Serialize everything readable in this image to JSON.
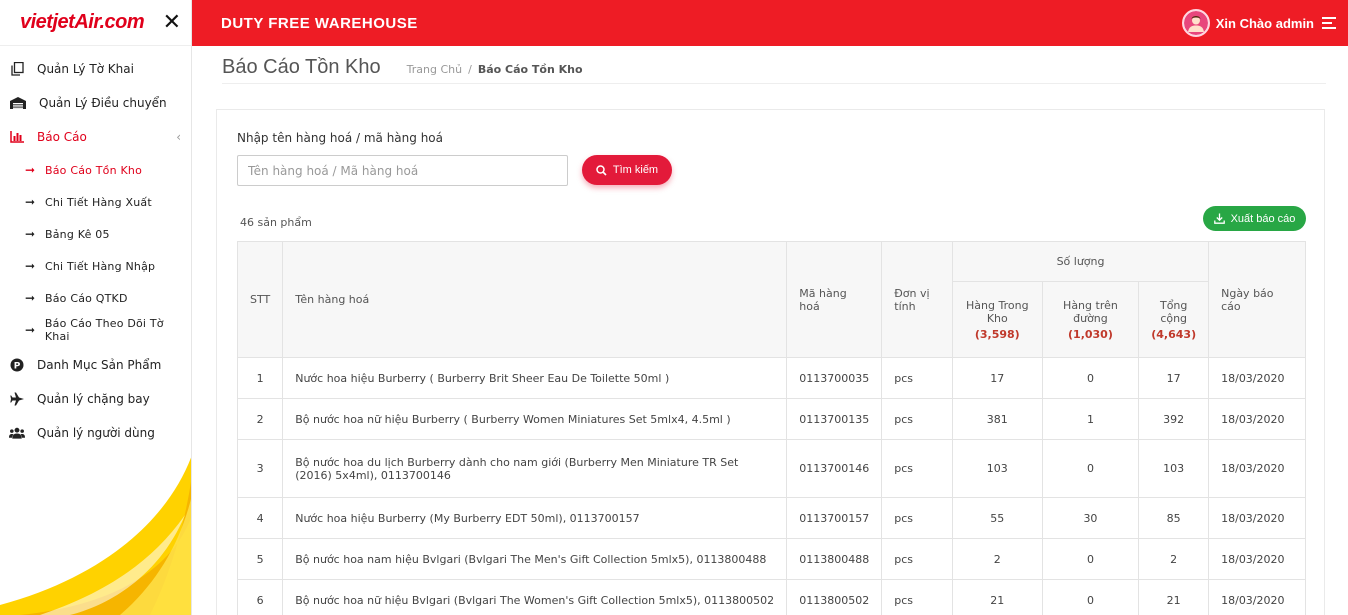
{
  "brand": {
    "logo_main": "vietjet",
    "logo_air": "Air",
    "logo_suffix": ".com"
  },
  "header": {
    "title": "DUTY FREE WAREHOUSE",
    "greeting": "Xin Chào admin"
  },
  "sidebar": {
    "items": [
      {
        "label": "Quản Lý Tờ Khai",
        "icon": "copy-icon"
      },
      {
        "label": "Quản Lý Điều chuyển",
        "icon": "warehouse-icon"
      },
      {
        "label": "Báo Cáo",
        "icon": "bar-chart-icon",
        "active": true
      }
    ],
    "sub_items": [
      {
        "label": "Báo Cáo Tồn Kho",
        "active": true
      },
      {
        "label": "Chi Tiết Hàng Xuất"
      },
      {
        "label": "Bảng Kê 05"
      },
      {
        "label": "Chi Tiết Hàng Nhập"
      },
      {
        "label": "Báo Cáo QTKD"
      },
      {
        "label": "Báo Cáo Theo Dõi Tờ Khai"
      }
    ],
    "bottom_items": [
      {
        "label": "Danh Mục Sản Phẩm",
        "icon": "product-p-icon"
      },
      {
        "label": "Quản lý chặng bay",
        "icon": "plane-icon"
      },
      {
        "label": "Quản lý người dùng",
        "icon": "users-icon"
      }
    ]
  },
  "page": {
    "title": "Báo Cáo Tồn Kho",
    "breadcrumb": {
      "home": "Trang Chủ",
      "separator": "/",
      "current": "Báo Cáo Tồn Kho"
    }
  },
  "search": {
    "label": "Nhập tên hàng hoá / mã hàng hoá",
    "placeholder": "Tên hàng hoá / Mã hàng hoá",
    "value": "",
    "button": "Tìm kiếm"
  },
  "summary": {
    "count_text": "46 sản phẩm",
    "export_button": "Xuất báo cáo"
  },
  "table": {
    "headers": {
      "stt": "STT",
      "name": "Tên hàng hoá",
      "code": "Mã hàng hoá",
      "unit": "Đơn vị tính",
      "quantity_group": "Số lượng",
      "in_stock": "Hàng Trong Kho",
      "in_stock_total": "(3,598)",
      "in_transit": "Hàng trên đường",
      "in_transit_total": "(1,030)",
      "total": "Tổng cộng",
      "total_total": "(4,643)",
      "date": "Ngày báo cáo"
    },
    "rows": [
      {
        "stt": "1",
        "name": "Nước hoa hiệu Burberry ( Burberry Brit Sheer Eau De Toilette 50ml )",
        "code": "0113700035",
        "unit": "pcs",
        "in_stock": "17",
        "in_transit": "0",
        "total": "17",
        "date": "18/03/2020"
      },
      {
        "stt": "2",
        "name": "Bộ nước hoa nữ hiệu Burberry ( Burberry Women Miniatures Set 5mlx4, 4.5ml )",
        "code": "0113700135",
        "unit": "pcs",
        "in_stock": "381",
        "in_transit": "1",
        "total": "392",
        "date": "18/03/2020"
      },
      {
        "stt": "3",
        "name": "Bộ nước hoa du lịch Burberry dành cho nam giới (Burberry Men Miniature TR Set (2016) 5x4ml), 0113700146",
        "code": "0113700146",
        "unit": "pcs",
        "in_stock": "103",
        "in_transit": "0",
        "total": "103",
        "date": "18/03/2020"
      },
      {
        "stt": "4",
        "name": "Nước hoa hiệu Burberry (My Burberry EDT 50ml), 0113700157",
        "code": "0113700157",
        "unit": "pcs",
        "in_stock": "55",
        "in_transit": "30",
        "total": "85",
        "date": "18/03/2020"
      },
      {
        "stt": "5",
        "name": "Bộ nước hoa nam hiệu Bvlgari (Bvlgari The Men's Gift Collection 5mlx5), 0113800488",
        "code": "0113800488",
        "unit": "pcs",
        "in_stock": "2",
        "in_transit": "0",
        "total": "2",
        "date": "18/03/2020"
      },
      {
        "stt": "6",
        "name": "Bộ nước hoa nữ hiệu Bvlgari (Bvlgari The Women's Gift Collection 5mlx5), 0113800502",
        "code": "0113800502",
        "unit": "pcs",
        "in_stock": "21",
        "in_transit": "0",
        "total": "21",
        "date": "18/03/2020"
      }
    ]
  },
  "colors": {
    "brand_red": "#ee1c25",
    "accent_red": "#e31a3a",
    "export_green": "#28a745",
    "swoosh_yellow": "#ffd200"
  }
}
